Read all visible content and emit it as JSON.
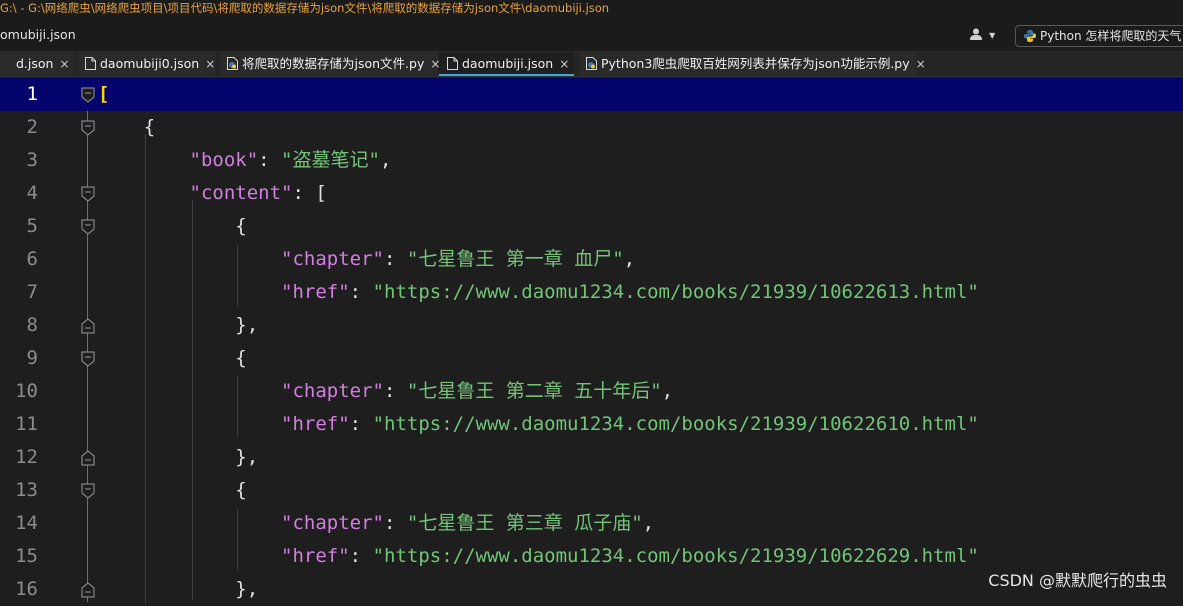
{
  "window": {
    "title": "G:\\ - G:\\网络爬虫\\网络爬虫项目\\项目代码\\将爬取的数据存储为json文件\\将爬取的数据存储为json文件\\daomubiji.json"
  },
  "toolbar": {
    "project_name": "omubiji.json",
    "search_text": "Python 怎样将爬取的天气"
  },
  "tabs": [
    {
      "label": "d.json",
      "icon": "json-file-icon",
      "active": false
    },
    {
      "label": "daomubiji0.json",
      "icon": "json-file-icon",
      "active": false
    },
    {
      "label": "将爬取的数据存储为json文件.py",
      "icon": "python-file-icon",
      "active": false
    },
    {
      "label": "daomubiji.json",
      "icon": "json-file-icon",
      "active": true
    },
    {
      "label": "Python3爬虫爬取百姓网列表并保存为json功能示例.py",
      "icon": "python-file-icon",
      "active": false
    }
  ],
  "tab_close_glyph": "×",
  "editor": {
    "current_line": 1,
    "line_numbers": [
      "1",
      "2",
      "3",
      "4",
      "5",
      "6",
      "7",
      "8",
      "9",
      "10",
      "11",
      "12",
      "13",
      "14",
      "15",
      "16"
    ],
    "keys": {
      "book": "\"book\"",
      "content": "\"content\"",
      "chapter": "\"chapter\"",
      "href": "\"href\""
    },
    "book_value": "\"盗墓笔记\"",
    "chapters": [
      {
        "chapter": "\"七星鲁王 第一章 血尸\"",
        "href": "\"https://www.daomu1234.com/books/21939/10622613.html\""
      },
      {
        "chapter": "\"七星鲁王 第二章 五十年后\"",
        "href": "\"https://www.daomu1234.com/books/21939/10622610.html\""
      },
      {
        "chapter": "\"七星鲁王 第三章 瓜子庙\"",
        "href": "\"https://www.daomu1234.com/books/21939/10622629.html\""
      }
    ]
  },
  "watermark": "CSDN @默默爬行的虫虫",
  "colors": {
    "key": "#d27fe0",
    "string": "#72c478",
    "current_line_bg": "#04046c",
    "active_tab_underline": "#3fa7d9",
    "title_text": "#e8a33a"
  }
}
